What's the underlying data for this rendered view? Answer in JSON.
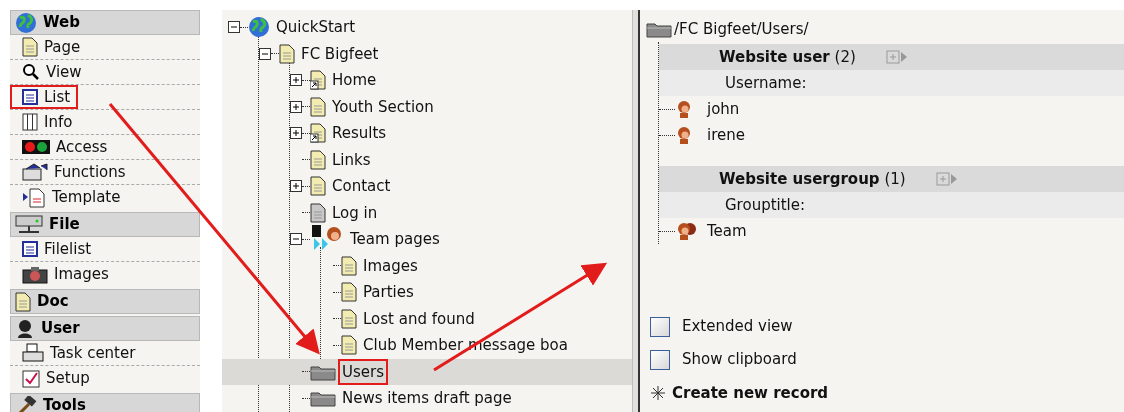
{
  "sidebar": {
    "groups": [
      {
        "title": "Web",
        "items": [
          {
            "label": "Page",
            "highlighted": false
          },
          {
            "label": "View",
            "highlighted": false
          },
          {
            "label": "List",
            "highlighted": true
          },
          {
            "label": "Info",
            "highlighted": false
          },
          {
            "label": "Access",
            "highlighted": false
          },
          {
            "label": "Functions",
            "highlighted": false
          },
          {
            "label": "Template",
            "highlighted": false
          }
        ]
      },
      {
        "title": "File",
        "items": [
          {
            "label": "Filelist",
            "highlighted": false
          },
          {
            "label": "Images",
            "highlighted": false
          }
        ]
      },
      {
        "title": "Doc"
      },
      {
        "title": "User",
        "items": [
          {
            "label": "Task center",
            "highlighted": false
          },
          {
            "label": "Setup",
            "highlighted": false
          }
        ]
      },
      {
        "title": "Tools"
      }
    ]
  },
  "page_tree": [
    {
      "label": "QuickStart",
      "kind": "site",
      "expanded": true,
      "selected": false,
      "highlighted": false,
      "children": [
        {
          "label": "FC Bigfeet",
          "kind": "page",
          "expanded": true,
          "selected": false,
          "highlighted": false,
          "children": [
            {
              "label": "Home",
              "kind": "shortcut",
              "expanded": false,
              "selected": false,
              "highlighted": false,
              "has_children": true
            },
            {
              "label": "Youth Section",
              "kind": "page",
              "expanded": false,
              "selected": false,
              "highlighted": false,
              "has_children": true
            },
            {
              "label": "Results",
              "kind": "shortcut",
              "expanded": false,
              "selected": false,
              "highlighted": false,
              "has_children": true
            },
            {
              "label": "Links",
              "kind": "page",
              "selected": false,
              "highlighted": false,
              "has_children": false
            },
            {
              "label": "Contact",
              "kind": "page",
              "expanded": false,
              "selected": false,
              "highlighted": false,
              "has_children": true
            },
            {
              "label": "Log in",
              "kind": "hidden",
              "selected": false,
              "highlighted": false,
              "has_children": false
            },
            {
              "label": "Team pages",
              "kind": "mount",
              "expanded": true,
              "selected": false,
              "highlighted": false,
              "children": [
                {
                  "label": "Images",
                  "kind": "page",
                  "selected": false,
                  "highlighted": false,
                  "has_children": false
                },
                {
                  "label": "Parties",
                  "kind": "page",
                  "selected": false,
                  "highlighted": false,
                  "has_children": false
                },
                {
                  "label": "Lost and found",
                  "kind": "page",
                  "selected": false,
                  "highlighted": false,
                  "has_children": false
                },
                {
                  "label": "Club Member message boa",
                  "kind": "page",
                  "selected": false,
                  "highlighted": false,
                  "has_children": false
                }
              ]
            },
            {
              "label": "Users",
              "kind": "folder",
              "selected": true,
              "highlighted": true,
              "has_children": false
            },
            {
              "label": "News items draft page",
              "kind": "folder",
              "selected": false,
              "highlighted": false,
              "has_children": false
            }
          ]
        }
      ]
    }
  ],
  "record_list": {
    "path": "/FC Bigfeet/Users/",
    "tables": [
      {
        "title": "Website user",
        "count": "(2)",
        "field": "Username:",
        "records": [
          {
            "name": "john",
            "kind": "user"
          },
          {
            "name": "irene",
            "kind": "user"
          }
        ]
      },
      {
        "title": "Website usergroup",
        "count": "(1)",
        "field": "Grouptitle:",
        "records": [
          {
            "name": "Team",
            "kind": "group"
          }
        ]
      }
    ],
    "options": [
      {
        "label": "Extended view",
        "checked": false
      },
      {
        "label": "Show clipboard",
        "checked": false
      }
    ],
    "create_link": "Create new record"
  }
}
